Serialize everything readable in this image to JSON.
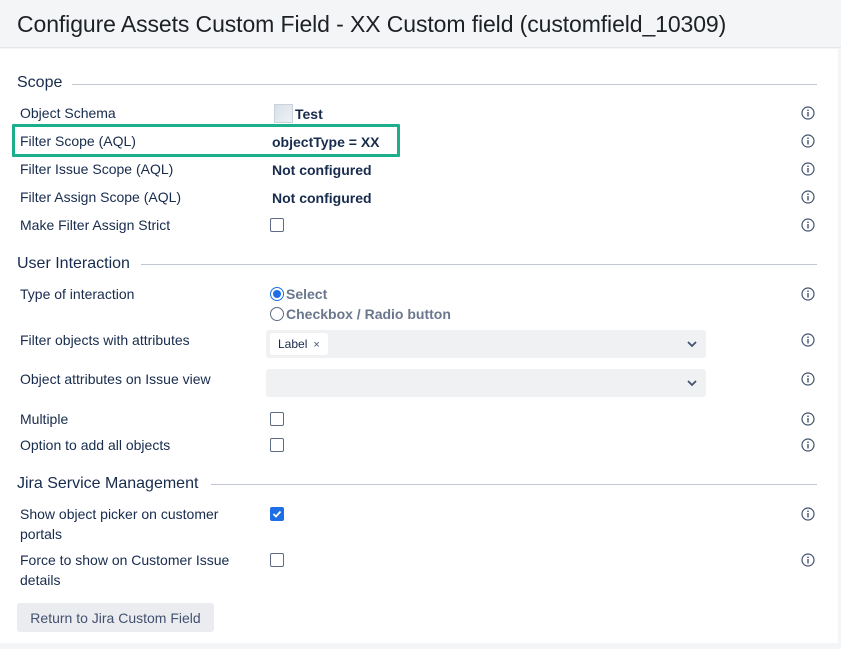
{
  "page": {
    "title": "Configure Assets Custom Field - XX Custom field (customfield_10309)"
  },
  "sections": {
    "scope": {
      "title": "Scope",
      "object_schema": {
        "label": "Object Schema",
        "value": "Test",
        "icon": "schema-icon"
      },
      "filter_scope": {
        "label": "Filter Scope (AQL)",
        "value": "objectType = XX"
      },
      "filter_issue_scope": {
        "label": "Filter Issue Scope (AQL)",
        "value": "Not configured"
      },
      "filter_assign_scope": {
        "label": "Filter Assign Scope (AQL)",
        "value": "Not configured"
      },
      "make_filter_assign_strict": {
        "label": "Make Filter Assign Strict",
        "checked": false
      }
    },
    "user_interaction": {
      "title": "User Interaction",
      "type_of_interaction": {
        "label": "Type of interaction",
        "options": [
          {
            "label": "Select",
            "selected": true
          },
          {
            "label": "Checkbox / Radio button",
            "selected": false
          }
        ]
      },
      "filter_objects_with_attributes": {
        "label": "Filter objects with attributes",
        "tags": [
          "Label"
        ]
      },
      "object_attributes_on_issue_view": {
        "label": "Object attributes on Issue view",
        "tags": []
      },
      "multiple": {
        "label": "Multiple",
        "checked": false
      },
      "option_add_all": {
        "label": "Option to add all objects",
        "checked": false
      }
    },
    "jsm": {
      "title": "Jira Service Management",
      "show_picker_line1": "Show object picker on customer",
      "show_picker_line2": "portals",
      "show_picker_checked": true,
      "force_show_line1": "Force to show on Customer Issue",
      "force_show_line2": "details",
      "force_show_checked": false
    }
  },
  "buttons": {
    "return_label": "Return to Jira Custom Field"
  },
  "icons": {
    "info": "info-icon",
    "chevron": "chevron-down-icon",
    "remove": "×"
  },
  "colors": {
    "highlight": "#1baf8c",
    "accent": "#1e6fe6"
  }
}
